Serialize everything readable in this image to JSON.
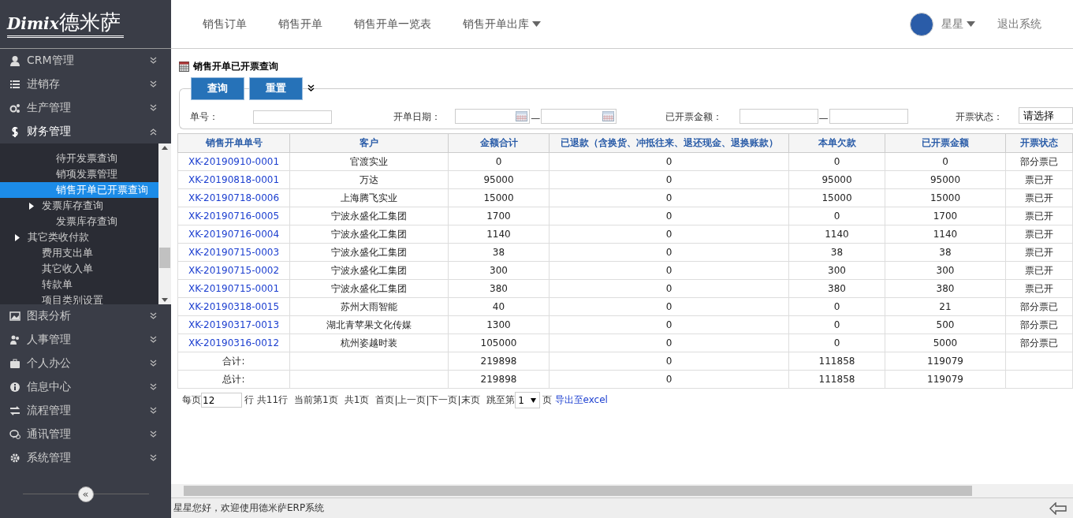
{
  "logo": {
    "latin": "Dimix",
    "name": "德米萨"
  },
  "top_nav": [
    {
      "label": "销售订单",
      "has_dropdown": false
    },
    {
      "label": "销售开单",
      "has_dropdown": false
    },
    {
      "label": "销售开单一览表",
      "has_dropdown": false
    },
    {
      "label": "销售开单出库",
      "has_dropdown": true
    }
  ],
  "user": {
    "name": "星星",
    "logout": "退出系统"
  },
  "sidebar": {
    "menus": [
      {
        "label": "CRM管理",
        "expanded": false
      },
      {
        "label": "进销存",
        "expanded": false
      },
      {
        "label": "生产管理",
        "expanded": false
      },
      {
        "label": "财务管理",
        "expanded": true,
        "children": [
          {
            "children": [
              {
                "children": [
                  {
                    "label": "待开发票查询",
                    "selected": false
                  },
                  {
                    "label": "销项发票管理",
                    "selected": false
                  },
                  {
                    "label": "销售开单已开票查询",
                    "selected": true
                  }
                ]
              },
              {
                "label": "发票库存查询",
                "selected": false,
                "children": [
                  {
                    "label": "发票库存查询",
                    "selected": false
                  }
                ]
              }
            ]
          },
          {
            "label": "其它类收付款",
            "selected": false,
            "children": [
              {
                "label": "费用支出单",
                "selected": false
              },
              {
                "label": "其它收入单",
                "selected": false
              },
              {
                "label": "转款单",
                "selected": false
              },
              {
                "label": "项目类别设置",
                "selected": false
              }
            ]
          }
        ]
      },
      {
        "label": "图表分析",
        "expanded": false
      },
      {
        "label": "人事管理",
        "expanded": false
      },
      {
        "label": "个人办公",
        "expanded": false
      },
      {
        "label": "信息中心",
        "expanded": false
      },
      {
        "label": "流程管理",
        "expanded": false
      },
      {
        "label": "通讯管理",
        "expanded": false
      },
      {
        "label": "系统管理",
        "expanded": false
      }
    ],
    "collapse": "«"
  },
  "page_title": "销售开单已开票查询",
  "buttons": [
    "查询",
    "重置"
  ],
  "filters": [
    {
      "label": "单号：",
      "kind": "text"
    },
    {
      "label": "开单日期：",
      "kind": "date_range",
      "separator": "—"
    },
    {
      "label": "已开票金额：",
      "kind": "range",
      "separator": "—"
    },
    {
      "label": "开票状态：",
      "kind": "select",
      "value": "请选择"
    }
  ],
  "table": {
    "columns": [
      "销售开单单号",
      "客户",
      "金额合计",
      "已退款（含换货、冲抵往来、退还现金、退换账款）",
      "本单欠款",
      "已开票金额",
      "开票状态"
    ],
    "rows": [
      {
        "kind": "data",
        "cells": [
          "XK-20190910-0001",
          "官渡实业",
          "0",
          "0",
          "0",
          "0",
          "部分票已"
        ]
      },
      {
        "kind": "data",
        "cells": [
          "XK-20190818-0001",
          "万达",
          "95000",
          "0",
          "95000",
          "95000",
          "票已开"
        ]
      },
      {
        "kind": "data",
        "cells": [
          "XK-20190718-0006",
          "上海腾飞实业",
          "15000",
          "0",
          "15000",
          "15000",
          "票已开"
        ]
      },
      {
        "kind": "data",
        "cells": [
          "XK-20190716-0005",
          "宁波永盛化工集团",
          "1700",
          "0",
          "0",
          "1700",
          "票已开"
        ]
      },
      {
        "kind": "data",
        "cells": [
          "XK-20190716-0004",
          "宁波永盛化工集团",
          "1140",
          "0",
          "1140",
          "1140",
          "票已开"
        ]
      },
      {
        "kind": "data",
        "cells": [
          "XK-20190715-0003",
          "宁波永盛化工集团",
          "38",
          "0",
          "38",
          "38",
          "票已开"
        ]
      },
      {
        "kind": "data",
        "cells": [
          "XK-20190715-0002",
          "宁波永盛化工集团",
          "300",
          "0",
          "300",
          "300",
          "票已开"
        ]
      },
      {
        "kind": "data",
        "cells": [
          "XK-20190715-0001",
          "宁波永盛化工集团",
          "380",
          "0",
          "380",
          "380",
          "票已开"
        ]
      },
      {
        "kind": "data",
        "cells": [
          "XK-20190318-0015",
          "苏州大雨智能",
          "40",
          "0",
          "0",
          "21",
          "部分票已"
        ]
      },
      {
        "kind": "data",
        "cells": [
          "XK-20190317-0013",
          "湖北青苹果文化传媒",
          "1300",
          "0",
          "0",
          "500",
          "部分票已"
        ]
      },
      {
        "kind": "data",
        "cells": [
          "XK-20190316-0012",
          "杭州姿越时装",
          "105000",
          "0",
          "0",
          "5000",
          "部分票已"
        ]
      },
      {
        "kind": "total",
        "cells": [
          "合计:",
          "",
          "219898",
          "0",
          "111858",
          "119079",
          ""
        ]
      },
      {
        "kind": "total",
        "cells": [
          "总计:",
          "",
          "219898",
          "0",
          "111858",
          "119079",
          ""
        ]
      }
    ]
  },
  "pager": {
    "per_page_label": "每页",
    "per_page": "12",
    "rows_text": "行 共11行",
    "current": "当前第1页",
    "total_pages": "共1页",
    "links": [
      "首页",
      "上一页",
      "下一页",
      "末页"
    ],
    "separator": "|",
    "jump_label": "跳至第",
    "jump_value": "1",
    "page_suffix": "页",
    "export": "导出至excel"
  },
  "status_bar": "星星您好，欢迎使用德米萨ERP系统"
}
